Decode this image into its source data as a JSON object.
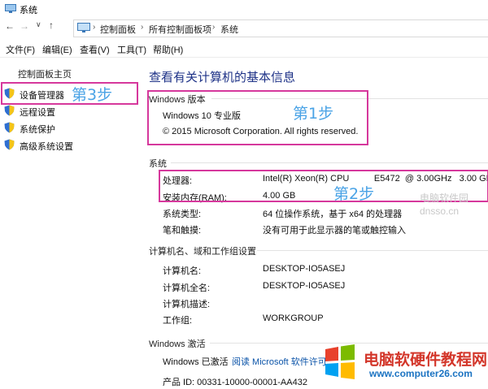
{
  "window": {
    "title": "系统"
  },
  "address": {
    "crumbs": [
      "控制面板",
      "所有控制面板项",
      "系统"
    ]
  },
  "menu": [
    "文件(F)",
    "编辑(E)",
    "查看(V)",
    "工具(T)",
    "帮助(H)"
  ],
  "sidebar": {
    "home": "控制面板主页",
    "links": [
      "设备管理器",
      "远程设置",
      "系统保护",
      "高级系统设置"
    ]
  },
  "main": {
    "title": "查看有关计算机的基本信息",
    "edition": {
      "heading": "Windows 版本",
      "name": "Windows 10 专业版",
      "copyright": "© 2015 Microsoft Corporation. All rights reserved."
    },
    "system": {
      "heading": "系统",
      "rows": [
        {
          "label": "处理器:",
          "value": "Intel(R) Xeon(R) CPU          E5472  @ 3.00GHz   3.00 GHz"
        },
        {
          "label": "安装内存(RAM):",
          "value": "4.00 GB"
        },
        {
          "label": "系统类型:",
          "value": "64 位操作系统，基于 x64 的处理器"
        },
        {
          "label": "笔和触摸:",
          "value": "没有可用于此显示器的笔或触控输入"
        }
      ]
    },
    "computer": {
      "heading": "计算机名、域和工作组设置",
      "rows": [
        {
          "label": "计算机名:",
          "value": "DESKTOP-IO5ASEJ"
        },
        {
          "label": "计算机全名:",
          "value": "DESKTOP-IO5ASEJ"
        },
        {
          "label": "计算机描述:",
          "value": ""
        },
        {
          "label": "工作组:",
          "value": "WORKGROUP"
        }
      ]
    },
    "activation": {
      "heading": "Windows 激活",
      "status": "Windows 已激活",
      "link": "阅读 Microsoft 软件许可",
      "product_id": "产品 ID: 00331-10000-00001-AA432"
    }
  },
  "annotations": {
    "step1": "第1步",
    "step2": "第2步",
    "step3": "第3步"
  },
  "watermarks": {
    "brand": "电脑软硬件教程网",
    "url": "www.computer26.com",
    "corner": "电脑软件园 dnsso.cn"
  },
  "colors": {
    "annotation_box": "#d6389c",
    "annotation_text": "#4aa3e6",
    "title": "#1e3287",
    "link": "#0a53a8"
  }
}
